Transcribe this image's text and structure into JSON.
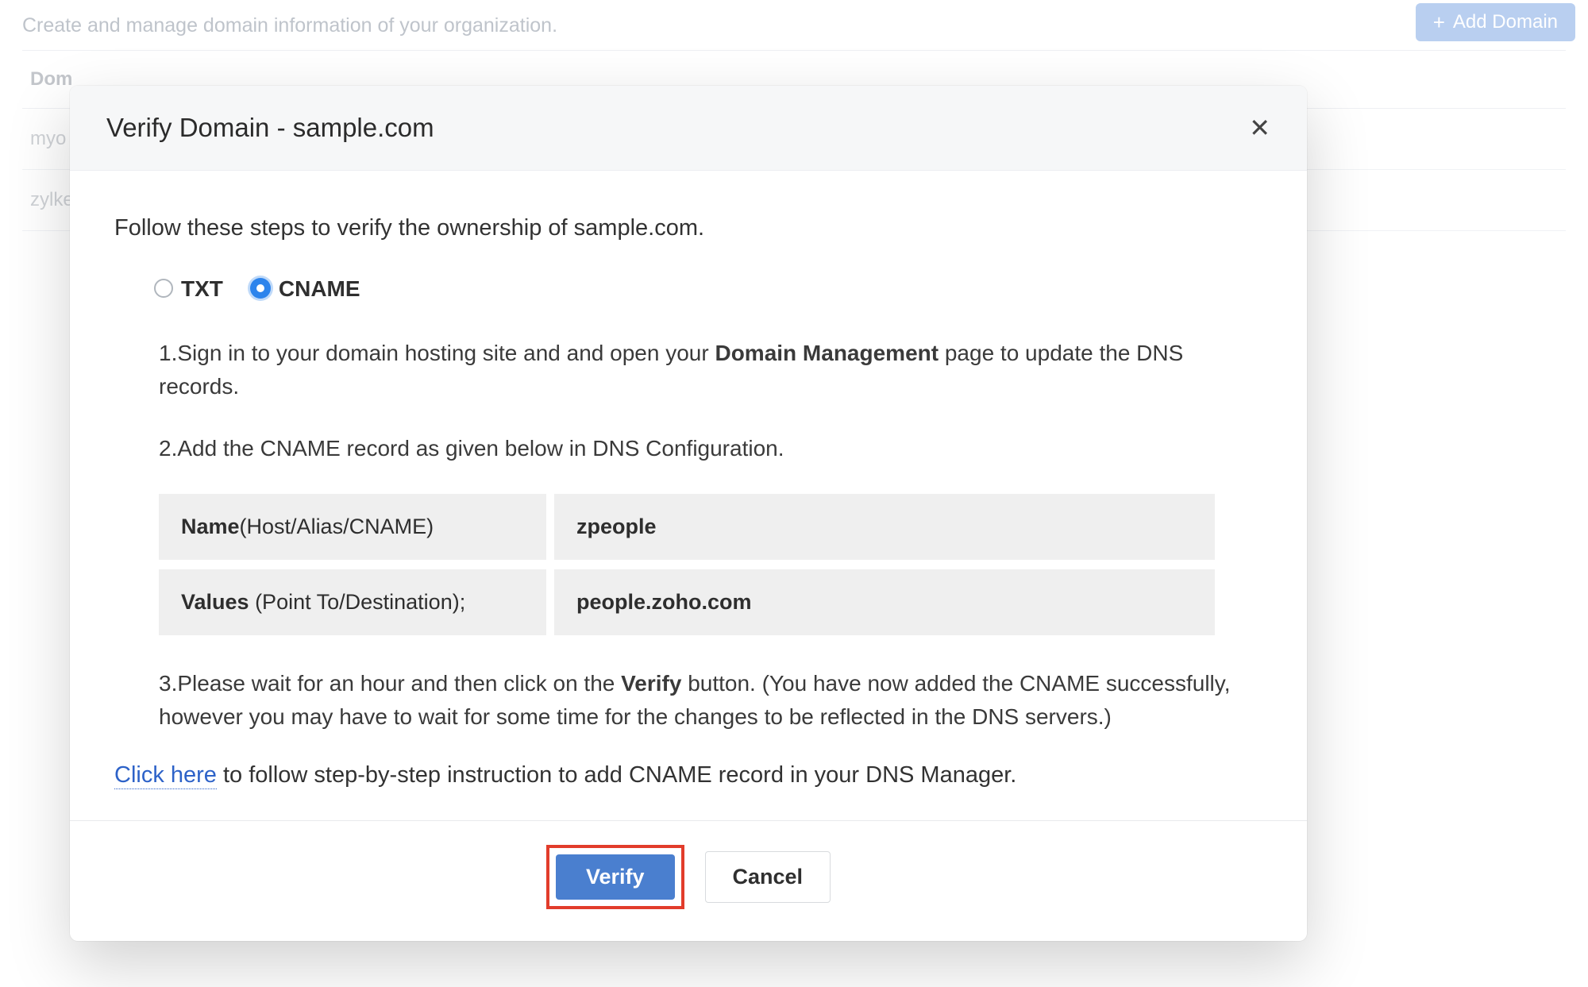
{
  "page": {
    "subtitle": "Create and manage domain information of your organization.",
    "add_domain_button": "Add Domain"
  },
  "table": {
    "header_left": "Dom",
    "rows": [
      "myo",
      "zylke"
    ]
  },
  "modal": {
    "title": "Verify Domain - sample.com",
    "intro": "Follow these steps to verify the ownership of sample.com.",
    "radio_txt": "TXT",
    "radio_cname": "CNAME",
    "step1_prefix": "1.Sign in to your domain hosting site and and open your ",
    "step1_bold": "Domain Management",
    "step1_suffix": " page to update the DNS records.",
    "step2": "2.Add the CNAME record as given below in DNS Configuration.",
    "kv_name_bold": "Name",
    "kv_name_rest": "(Host/Alias/CNAME)",
    "kv_name_value": "zpeople",
    "kv_values_bold": "Values",
    "kv_values_rest": " (Point To/Destination);",
    "kv_values_value": "people.zoho.com",
    "step3_prefix": "3.Please wait for an hour and then click on the ",
    "step3_bold": "Verify",
    "step3_suffix": " button. (You have now added the CNAME successfully, however you may have to wait for some time for the changes to be reflected in the DNS servers.)",
    "clickhere_link": "Click here",
    "clickhere_rest": " to follow step-by-step instruction to add CNAME record in your DNS Manager.",
    "verify_label": "Verify",
    "cancel_label": "Cancel"
  }
}
